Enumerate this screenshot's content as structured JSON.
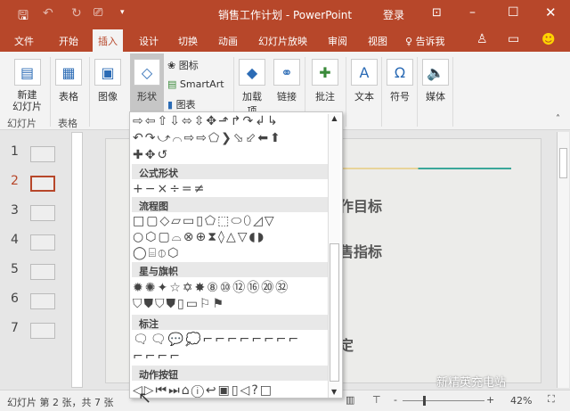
{
  "titlebar": {
    "title": "销售工作计划 - PowerPoint",
    "login": "登录",
    "qat": [
      "save-icon",
      "undo-icon",
      "redo-icon",
      "present-icon",
      "customize-icon"
    ]
  },
  "tabs": [
    "文件",
    "开始",
    "插入",
    "设计",
    "切换",
    "动画",
    "幻灯片放映",
    "审阅",
    "视图",
    "告诉我"
  ],
  "ribbon": {
    "new_slide": "新建\n幻灯片",
    "table": "表格",
    "image": "图像",
    "shapes": "形状",
    "icons": "图标",
    "smartart": "SmartArt",
    "chart": "图表",
    "addins": "加载项",
    "links": "链接",
    "comment": "批注",
    "text": "文本",
    "symbols": "符号",
    "media": "媒体",
    "group_slides": "幻灯片",
    "group_tables": "表格",
    "text_glyph": "A",
    "symbol_glyph": "Ω"
  },
  "gallery": {
    "rows": [
      {
        "type": "shapes",
        "glyphs": "⇨⇦⇧⇩⬄⇳✥⬏↱↷↲↳"
      },
      {
        "type": "shapes",
        "glyphs": "↶↷⤻⌒⇨⇨⬠❯⬂⬃⬅⬆"
      },
      {
        "type": "shapes",
        "glyphs": "✚✥↺"
      },
      {
        "type": "header",
        "label": "公式形状"
      },
      {
        "type": "shapes",
        "glyphs": "+−×÷=≠"
      },
      {
        "type": "header",
        "label": "流程图"
      },
      {
        "type": "shapes",
        "glyphs": "□▢◇▱▭▯⬠⬚⬭⬯◿▽"
      },
      {
        "type": "shapes",
        "glyphs": "○⬡▢⌓⊗⊕⧗◊△▽◖◗"
      },
      {
        "type": "shapes",
        "glyphs": "◯⌸⦶⬡"
      },
      {
        "type": "header",
        "label": "星与旗帜"
      },
      {
        "type": "shapes",
        "glyphs": "✹✺✦☆✡✸⑧⑩⑫⑯⑳㉜"
      },
      {
        "type": "shapes",
        "glyphs": "⛉⛊⛉⛊▯▭⚐⚑"
      },
      {
        "type": "header",
        "label": "标注"
      },
      {
        "type": "shapes",
        "glyphs": "🗨🗨💬💭⌐⌐⌐⌐⌐⌐⌐⌐"
      },
      {
        "type": "shapes",
        "glyphs": "⌐⌐⌐⌐"
      },
      {
        "type": "header",
        "label": "动作按钮"
      },
      {
        "type": "shapes",
        "glyphs": "◁▷⏮⏭⌂ⓘ↩▣▯◁?□"
      }
    ]
  },
  "thumbnails": [
    {
      "num": "1"
    },
    {
      "num": "2",
      "selected": true
    },
    {
      "num": "3"
    },
    {
      "num": "4"
    },
    {
      "num": "5"
    },
    {
      "num": "6"
    },
    {
      "num": "7"
    }
  ],
  "slide": {
    "lines": [
      "作目标",
      "售指标",
      "定"
    ]
  },
  "status": {
    "text": "幻灯片 第 2 张，共 7 张",
    "zoom": "42%",
    "minus": "-",
    "plus": "+"
  },
  "watermark": "新精英充电站",
  "colors": {
    "accent": "#b7472a",
    "ribbon": "#f3f3f3"
  }
}
